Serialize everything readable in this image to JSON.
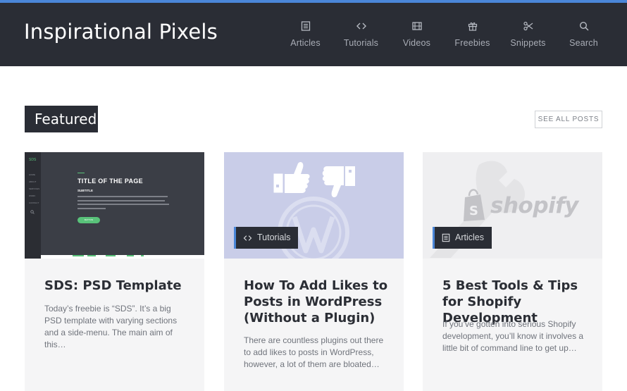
{
  "site": {
    "logo": "Inspirational Pixels",
    "accent": "#4a86d8",
    "header_bg": "#2a2d35"
  },
  "nav": [
    {
      "label": "Articles",
      "icon": "document-icon"
    },
    {
      "label": "Tutorials",
      "icon": "code-icon"
    },
    {
      "label": "Videos",
      "icon": "film-icon"
    },
    {
      "label": "Freebies",
      "icon": "gift-icon"
    },
    {
      "label": "Snippets",
      "icon": "scissors-icon"
    },
    {
      "label": "Search",
      "icon": "search-icon"
    }
  ],
  "section": {
    "title": "Featured",
    "see_all": "SEE ALL POSTS"
  },
  "cards": [
    {
      "title": "SDS: PSD Template",
      "excerpt": "Today’s freebie is “SDS”. It’s a big PSD template with varying sections and a side-menu. The main aim of this…",
      "category": "",
      "thumb": {
        "brand": "SDS",
        "menu": [
          "HOME",
          "ABOUT",
          "SERVICES",
          "WORK",
          "CONTACT"
        ],
        "page_title": "TITLE OF THE PAGE",
        "subtitle": "SUBTITLE",
        "button": "BUTTON"
      }
    },
    {
      "title": "How To Add Likes to Posts in WordPress (Without a Plugin)",
      "excerpt": "There are countless plugins out there to add likes to posts in WordPress, however, a lot of them are bloated…",
      "category": "Tutorials",
      "category_icon": "code-icon"
    },
    {
      "title": "5 Best Tools & Tips for Shopify Development",
      "excerpt": "If you’ve gotten into serious Shopify development, you’ll know it involves a little bit of command line to get up…",
      "category": "Articles",
      "category_icon": "document-icon",
      "thumb": {
        "brand": "shopify"
      }
    }
  ]
}
